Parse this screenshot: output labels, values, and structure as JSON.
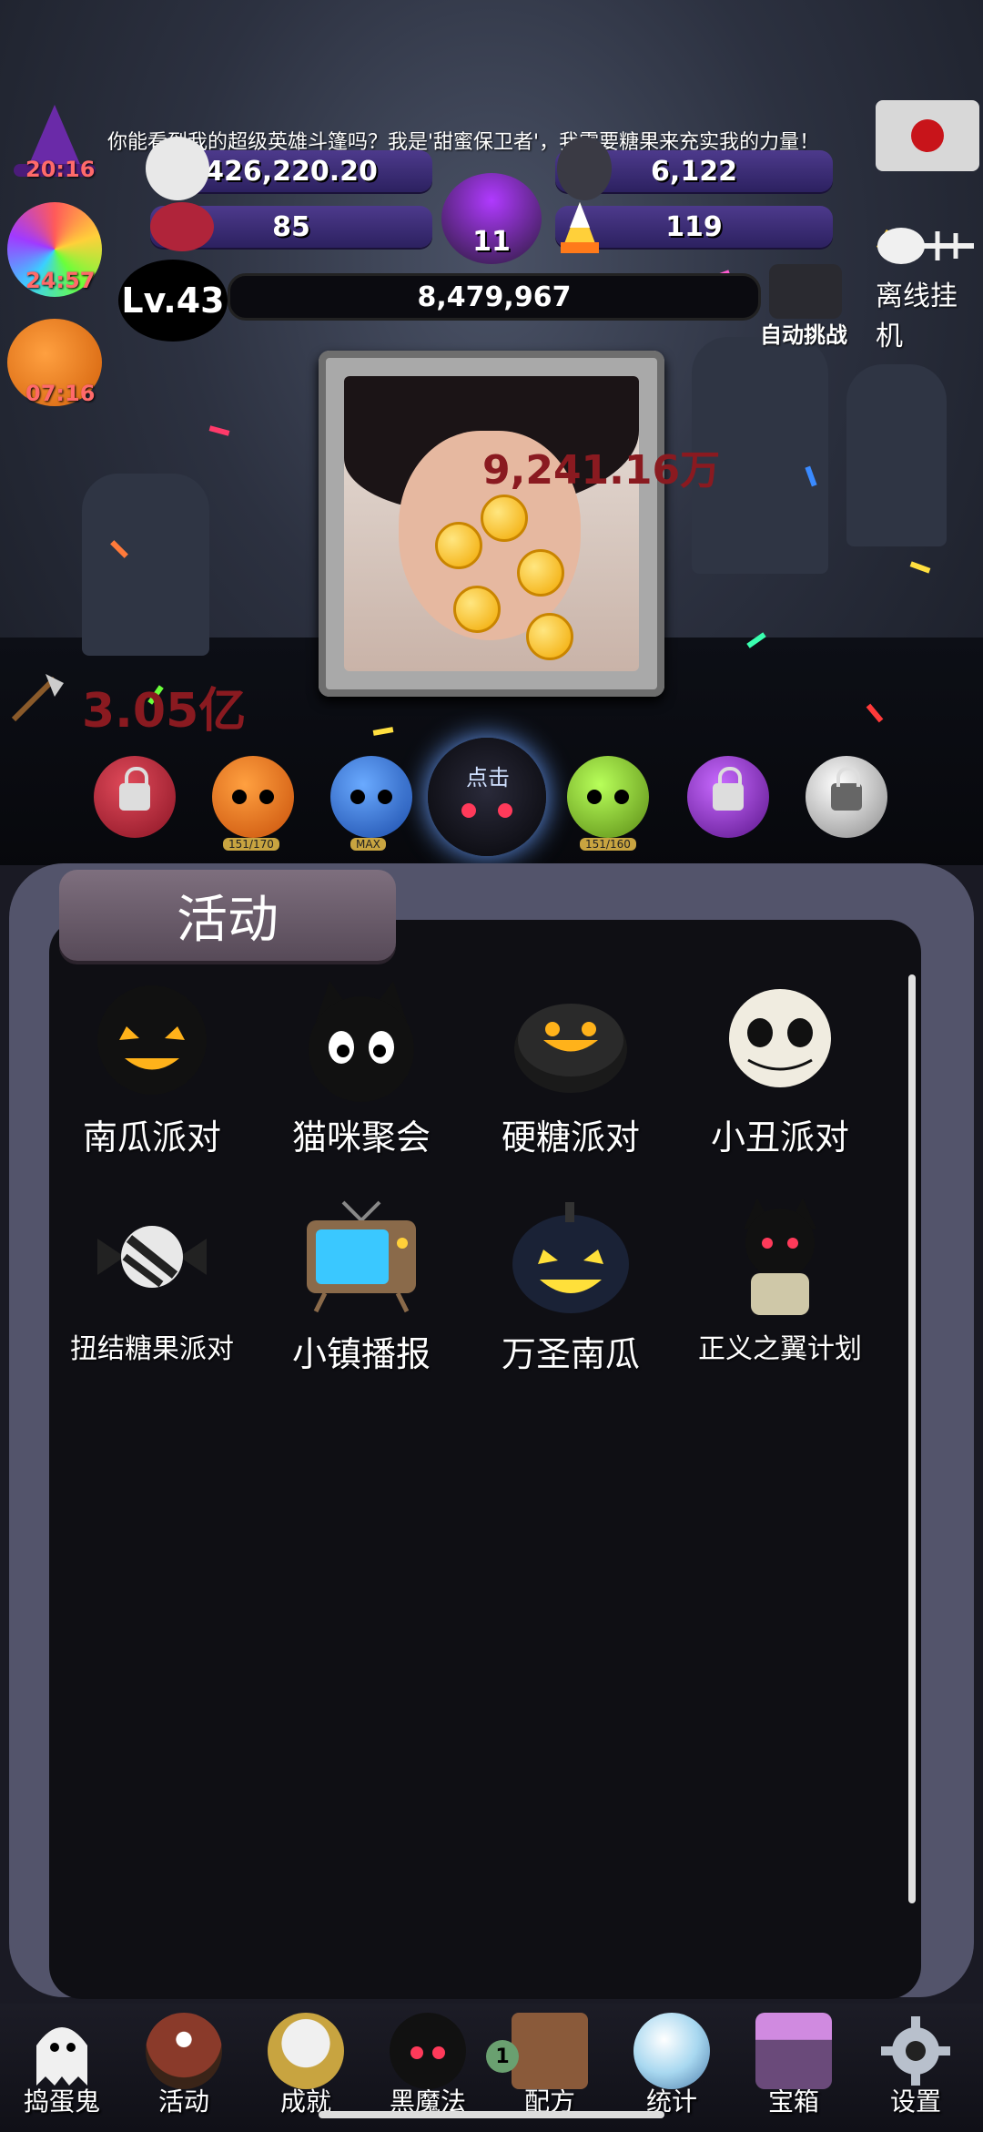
{
  "ticker": "你能看到我的超级英雄斗篷吗？我是'甜蜜保卫者'，我需要糖果来充实我的力量！",
  "timers": {
    "witch": "20:16",
    "candy": "24:57",
    "pumpkin": "07:16"
  },
  "stats": {
    "skull_candy": "426,220.20",
    "skull_bottle": "6,122",
    "bow_skull": "85",
    "cauldron": "11",
    "candy_corn": "119"
  },
  "level": "Lv.43",
  "xp": "8,479,967",
  "auto_challenge": "自动挑战",
  "offline": "离线挂机",
  "damage_float": "9,241.16万",
  "damage_left": "3.05亿",
  "monsters": [
    {
      "name": "red-locked",
      "color": "#b0243a",
      "locked": true,
      "tag": ""
    },
    {
      "name": "orange",
      "color": "#f07a1a",
      "locked": false,
      "tag": "151/170"
    },
    {
      "name": "blue",
      "color": "#3a7ad8",
      "locked": false,
      "tag": "MAX"
    },
    {
      "name": "black-cat",
      "color": "#101010",
      "locked": false,
      "tag": "点击"
    },
    {
      "name": "green",
      "color": "#8fc23a",
      "locked": false,
      "tag": "151/160"
    },
    {
      "name": "purple-locked",
      "color": "#8a2cc8",
      "locked": true,
      "tag": ""
    },
    {
      "name": "silver-locked",
      "color": "#c8c8c8",
      "locked": true,
      "tag": ""
    }
  ],
  "panel": {
    "title": "活动",
    "activities": [
      {
        "label": "南瓜派对",
        "icon": "jack-o-lantern-icon"
      },
      {
        "label": "猫咪聚会",
        "icon": "black-cat-icon"
      },
      {
        "label": "硬糖派对",
        "icon": "hard-candy-icon"
      },
      {
        "label": "小丑派对",
        "icon": "clown-skull-icon"
      },
      {
        "label": "扭结糖果派对",
        "icon": "wrapped-candy-icon"
      },
      {
        "label": "小镇播报",
        "icon": "tv-icon"
      },
      {
        "label": "万圣南瓜",
        "icon": "halloween-pumpkin-icon"
      },
      {
        "label": "正义之翼计划",
        "icon": "winged-bat-icon"
      }
    ]
  },
  "nav": [
    {
      "label": "捣蛋鬼",
      "icon": "ghost-icon"
    },
    {
      "label": "活动",
      "icon": "eyeball-cupcake-icon"
    },
    {
      "label": "成就",
      "icon": "skull-trophy-icon"
    },
    {
      "label": "黑魔法",
      "icon": "demon-cat-icon"
    },
    {
      "label": "配方",
      "icon": "recipe-book-icon",
      "badge": "1"
    },
    {
      "label": "统计",
      "icon": "crystal-ball-icon"
    },
    {
      "label": "宝箱",
      "icon": "treasure-chest-icon"
    },
    {
      "label": "设置",
      "icon": "gear-icon"
    }
  ]
}
